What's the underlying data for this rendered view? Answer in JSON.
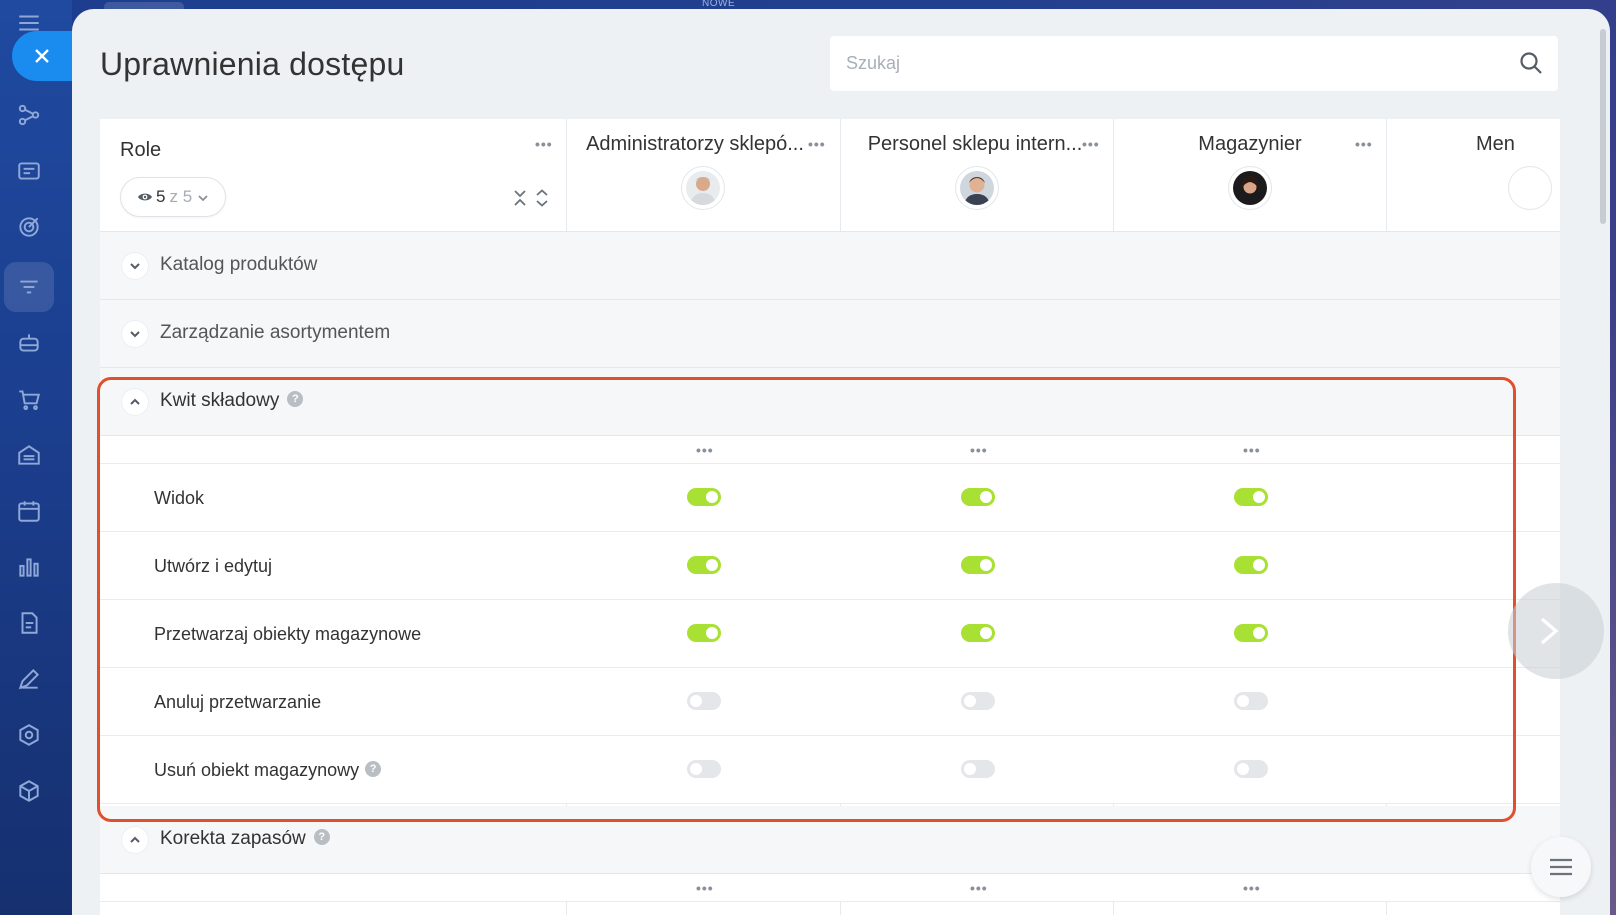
{
  "top_badge": "NOWE",
  "page": {
    "title": "Uprawnienia dostępu"
  },
  "search": {
    "placeholder": "Szukaj",
    "value": ""
  },
  "roles_column": {
    "label": "Role",
    "filter": {
      "shown": "5",
      "of_text": "z 5"
    }
  },
  "columns": [
    {
      "title": "Administratorzy sklepó...",
      "avatar": "man-avatar-gray-hair"
    },
    {
      "title": "Personel sklepu intern...",
      "avatar": "man-avatar-short-hair"
    },
    {
      "title": "Magazynier",
      "avatar": "woman-avatar-dark-hair"
    },
    {
      "title": "Men"
    }
  ],
  "sections": [
    {
      "title": "Katalog produktów",
      "expanded": false
    },
    {
      "title": "Zarządzanie asortymentem",
      "expanded": false
    },
    {
      "title": "Kwit składowy",
      "expanded": true,
      "has_help": true,
      "permissions": [
        {
          "label": "Widok",
          "values": [
            true,
            true,
            true
          ]
        },
        {
          "label": "Utwórz i edytuj",
          "values": [
            true,
            true,
            true
          ]
        },
        {
          "label": "Przetwarzaj obiekty magazynowe",
          "values": [
            true,
            true,
            true
          ]
        },
        {
          "label": "Anuluj przetwarzanie",
          "values": [
            false,
            false,
            false
          ]
        },
        {
          "label": "Usuń obiekt magazynowy",
          "values": [
            false,
            false,
            false
          ],
          "has_help": true
        }
      ]
    },
    {
      "title": "Korekta zapasów",
      "expanded": true,
      "has_help": true
    }
  ],
  "colors": {
    "toggle_on": "#a8e033",
    "toggle_off": "#e4e6e9",
    "highlight": "#e0502f",
    "close_button": "#1a8cf0"
  }
}
